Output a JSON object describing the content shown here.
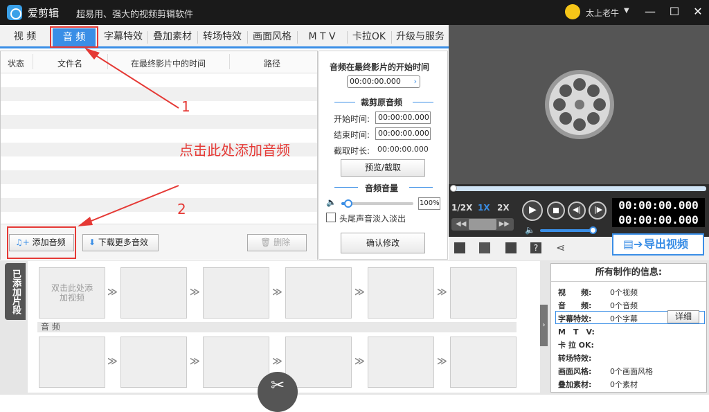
{
  "app": {
    "name": "爱剪辑",
    "slogan": "超易用、强大的视频剪辑软件",
    "user_name": "太上老牛"
  },
  "tabs": [
    "视 频",
    "音 频",
    "字幕特效",
    "叠加素材",
    "转场特效",
    "画面风格",
    "M T V",
    "卡拉OK",
    "升级与服务"
  ],
  "table": {
    "columns": [
      "状态",
      "文件名",
      "在最终影片中的时间",
      "路径"
    ]
  },
  "annotations": {
    "marker1": "1",
    "marker2": "2",
    "hint": "点击此处添加音频"
  },
  "buttons": {
    "add_audio": "添加音频",
    "download_more": "下载更多音效",
    "delete": "删除"
  },
  "audio_panel": {
    "start_title": "音频在最终影片的开始时间",
    "start_value": "00:00:00.000",
    "trim_title": "裁剪原音频",
    "start_label": "开始时间:",
    "start_time": "00:00:00.000",
    "end_label": "结束时间:",
    "end_time": "00:00:00.000",
    "duration_label": "截取时长:",
    "duration_value": "00:00:00.000",
    "preview_button": "预览/截取",
    "volume_title": "音频音量",
    "volume_value": "100%",
    "volume_level": 0.1,
    "fade_label": "头尾声音淡入淡出",
    "fade_checked": false,
    "confirm_button": "确认修改"
  },
  "player": {
    "speeds": [
      "1/2X",
      "1X",
      "2X"
    ],
    "active_speed": "1X",
    "time_current": "00:00:00.000",
    "time_total": "00:00:00.000",
    "export_label": "导出视频"
  },
  "timeline": {
    "side_tab": "已添加片段",
    "placeholder": "双击此处添加视频",
    "audio_label": "音 频"
  },
  "info": {
    "title": "所有制作的信息:",
    "rows": [
      {
        "label": "视　　频:",
        "value": "0个视频"
      },
      {
        "label": "音　　频:",
        "value": "0个音频"
      },
      {
        "label": "字幕特效:",
        "value": "0个字幕"
      },
      {
        "label": "M　T　V:",
        "value": ""
      },
      {
        "label": "卡 拉 OK:",
        "value": ""
      },
      {
        "label": "转场特效:",
        "value": ""
      },
      {
        "label": "画面风格:",
        "value": "0个画面风格"
      },
      {
        "label": "叠加素材:",
        "value": "0个素材"
      }
    ],
    "detail_button": "详细"
  },
  "colors": {
    "accent": "#3a8ee6",
    "annotation": "#e53935",
    "titlebar": "#1a1a1a"
  }
}
